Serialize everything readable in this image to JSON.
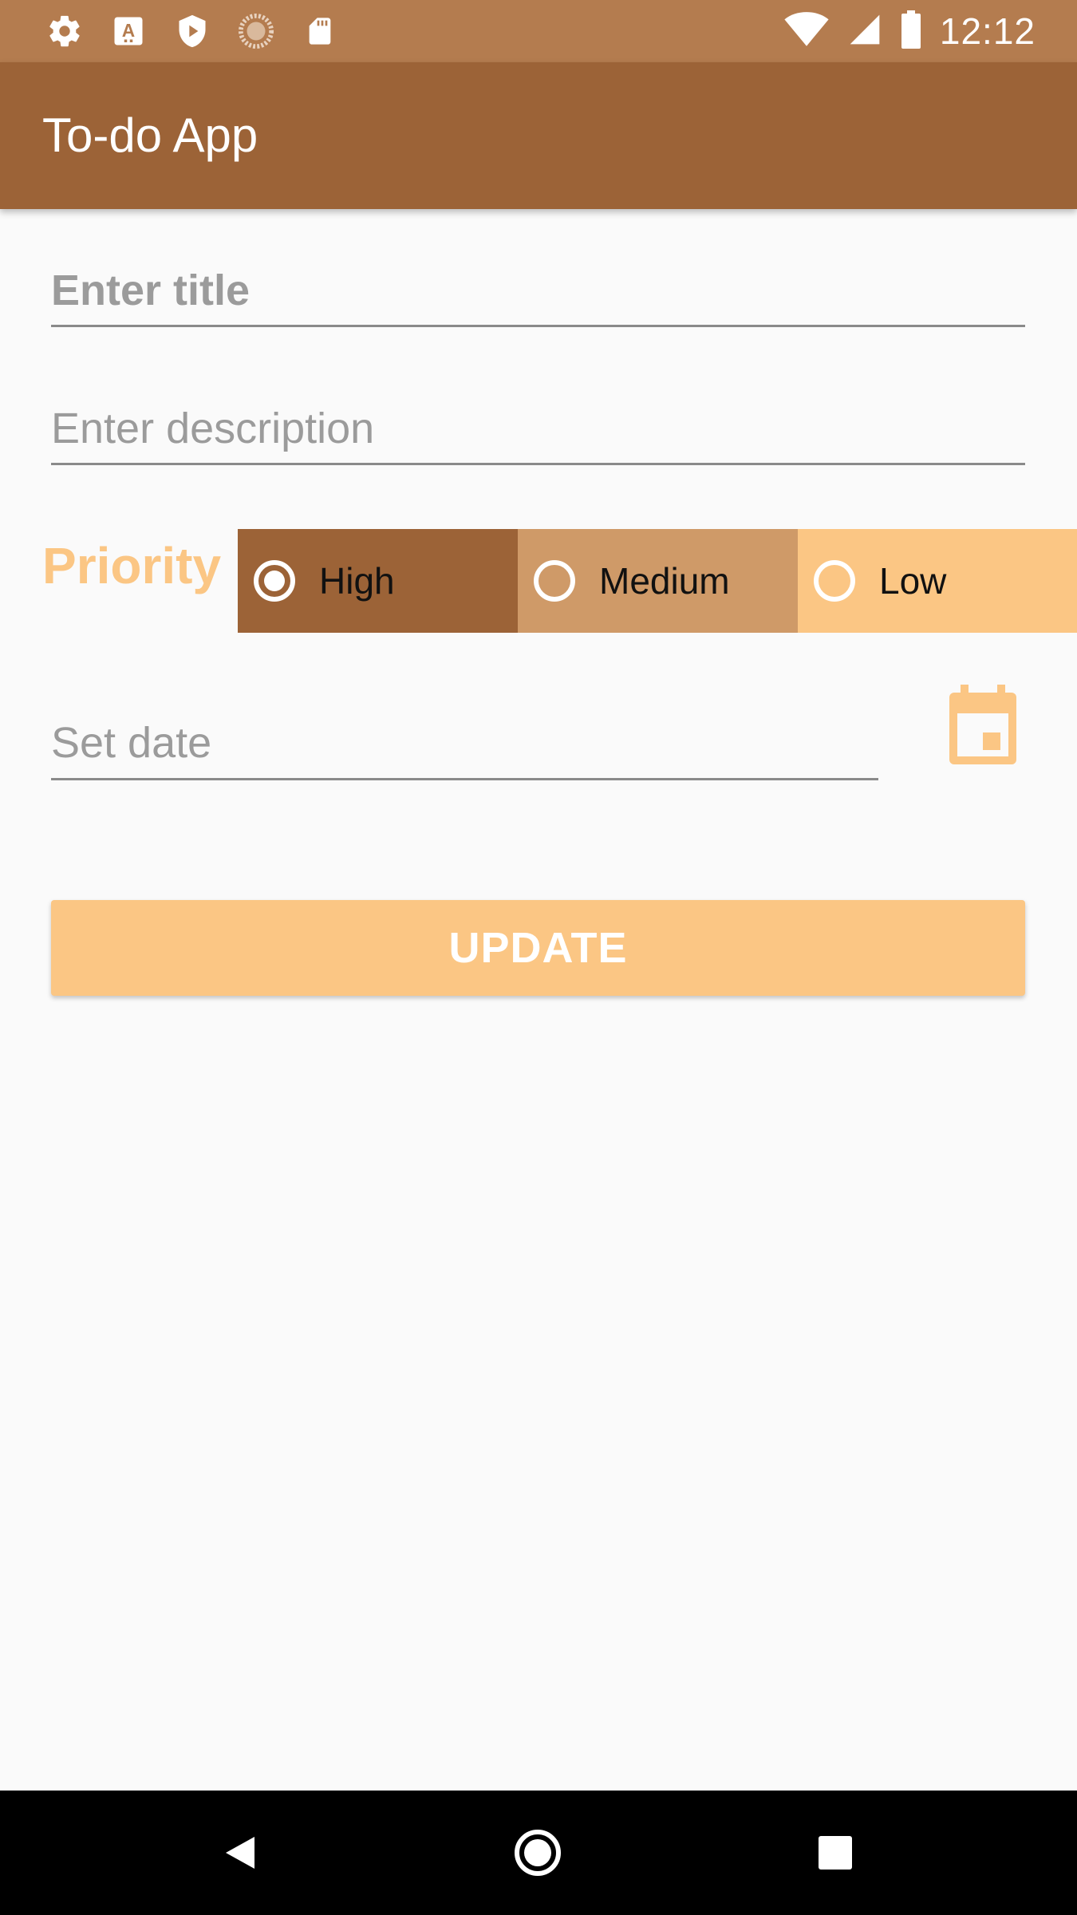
{
  "status_bar": {
    "time": "12:12",
    "left_icons": [
      "settings-icon",
      "font-a-icon",
      "play-shield-icon",
      "loading-circle-icon",
      "sd-card-icon"
    ],
    "right_icons": [
      "wifi-icon",
      "cellular-signal-icon",
      "battery-icon"
    ]
  },
  "app_bar": {
    "title": "To-do App"
  },
  "form": {
    "title_placeholder": "Enter title",
    "title_value": "",
    "description_placeholder": "Enter description",
    "description_value": "",
    "priority_label": "Priority",
    "priority_options": [
      {
        "label": "High",
        "selected": true,
        "color": "#9c6337"
      },
      {
        "label": "Medium",
        "selected": false,
        "color": "#cf9a68"
      },
      {
        "label": "Low",
        "selected": false,
        "color": "#fbc684"
      }
    ],
    "date_placeholder": "Set date",
    "date_value": "",
    "calendar_icon": "calendar-icon"
  },
  "update_button": {
    "label": "UPDATE"
  },
  "nav_bar": {
    "icons": [
      "back-icon",
      "home-icon",
      "recents-icon"
    ]
  },
  "colors": {
    "status_bar": "#b47c4f",
    "app_bar": "#9c6337",
    "accent": "#fbc684",
    "background": "#fafafa"
  }
}
